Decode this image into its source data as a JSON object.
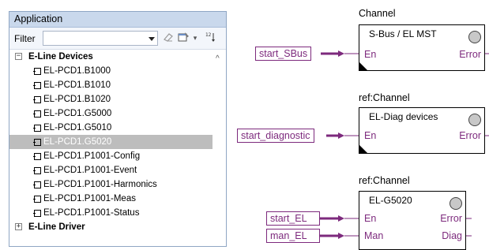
{
  "app_panel": {
    "title": "Application",
    "filter_label": "Filter",
    "filter_value": "",
    "groups": [
      {
        "label": "E-Line Devices",
        "expander": "−",
        "expanded": true,
        "items": [
          {
            "label": "EL-PCD1.B1000",
            "selected": false
          },
          {
            "label": "EL-PCD1.B1010",
            "selected": false
          },
          {
            "label": "EL-PCD1.B1020",
            "selected": false
          },
          {
            "label": "EL-PCD1.G5000",
            "selected": false
          },
          {
            "label": "EL-PCD1.G5010",
            "selected": false
          },
          {
            "label": "EL-PCD1.G5020",
            "selected": true
          },
          {
            "label": "EL-PCD1.P1001-Config",
            "selected": false
          },
          {
            "label": "EL-PCD1.P1001-Event",
            "selected": false
          },
          {
            "label": "EL-PCD1.P1001-Harmonics",
            "selected": false
          },
          {
            "label": "EL-PCD1.P1001-Meas",
            "selected": false
          },
          {
            "label": "EL-PCD1.P1001-Status",
            "selected": false
          }
        ]
      },
      {
        "label": "E-Line Driver",
        "expander": "+",
        "expanded": false,
        "items": []
      }
    ]
  },
  "diagram": {
    "blocks": [
      {
        "title": "Channel",
        "name": "S-Bus / EL MST",
        "inputs": [
          "En"
        ],
        "outputs": [
          "Error"
        ]
      },
      {
        "title": "ref:Channel",
        "name": "EL-Diag devices",
        "inputs": [
          "En"
        ],
        "outputs": [
          "Error"
        ]
      },
      {
        "title": "ref:Channel",
        "name": "EL-G5020",
        "inputs": [
          "En",
          "Man"
        ],
        "outputs": [
          "Error",
          "Diag"
        ]
      }
    ],
    "variables": [
      "start_SBus",
      "start_diagnostic",
      "start_EL",
      "man_EL"
    ],
    "colors": {
      "wire": "#7d2a7d",
      "selection": "#bdbdbd",
      "panel_header": "#c9d8ec"
    }
  }
}
